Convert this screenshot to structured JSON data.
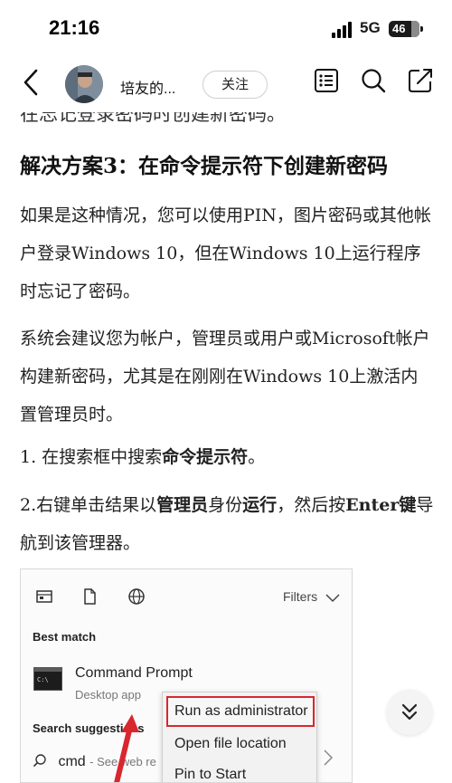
{
  "status_bar": {
    "time": "21:16",
    "network": "5G",
    "battery": "46"
  },
  "nav": {
    "author_name": "培友的...",
    "follow_label": "关注",
    "icons": [
      "back-icon",
      "list-icon",
      "search-icon",
      "share-icon"
    ]
  },
  "article": {
    "clipped_line": "在忘记登录密码时创建新密码。",
    "heading": "解决方案3：在命令提示符下创建新密码",
    "para1": "如果是这种情况，您可以使用PIN，图片密码或其他帐户登录Windows 10，但在Windows 10上运行程序时忘记了密码。",
    "para2": "系统会建议您为帐户，管理员或用户或Microsoft帐户构建新密码，尤其是在刚刚在Windows 10上激活内置管理员时。",
    "step1_prefix": "1. 在搜索框中搜索",
    "step1_bold": "命令提示符",
    "step1_suffix": "。",
    "step2_prefix": "2.右键单击结果以",
    "step2_bold1": "管理员",
    "step2_mid": "身份",
    "step2_bold2": "运行",
    "step2_mid2": "，然后按",
    "step2_bold3": "Enter键",
    "step2_suffix": "导航到该管理器。"
  },
  "screenshot": {
    "filters_label": "Filters",
    "best_match": "Best match",
    "app_title": "Command Prompt",
    "app_subtitle": "Desktop app",
    "search_suggestions": "Search suggestions",
    "cmd_query": "cmd",
    "cmd_hint": "- See web re",
    "menu_items": [
      "Run as administrator",
      "Open file location",
      "Pin to Start"
    ],
    "highlight_color": "#d9272e"
  }
}
